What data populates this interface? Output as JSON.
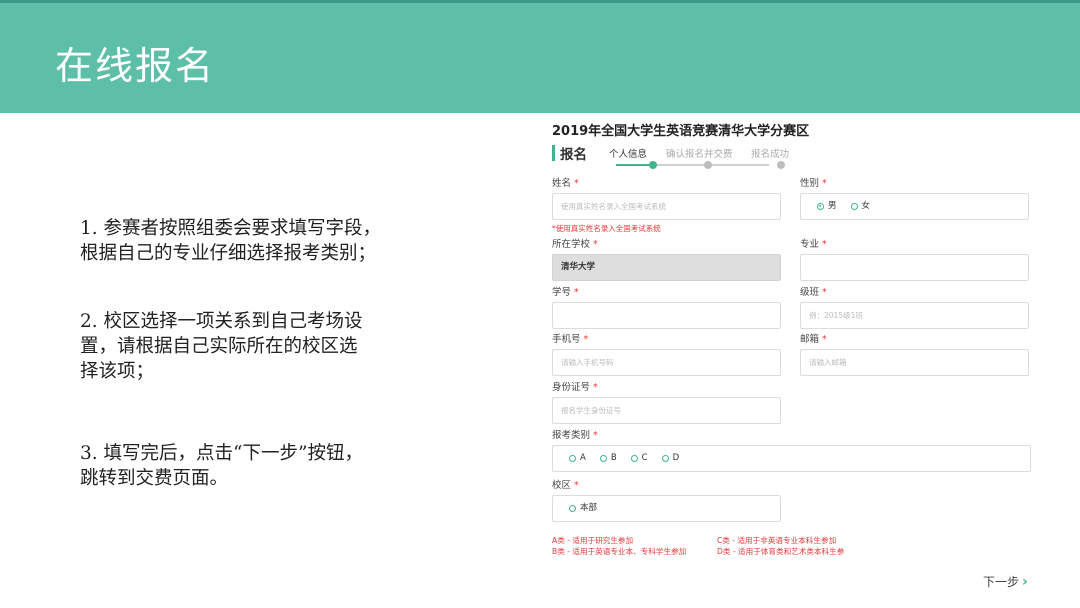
{
  "slide": {
    "title": "在线报名"
  },
  "instructions": [
    {
      "line1": "1. 参赛者按照组委会要求填写字段，",
      "line2": "根据自己的专业仔细选择报考类别；"
    },
    {
      "line1": "2. 校区选择一项关系到自己考场设",
      "line2": "置，请根据自己实际所在的校区选",
      "line3": "择该项；"
    },
    {
      "line1": "3. 填写完后，点击“下一步”按钮，",
      "line2": "跳转到交费页面。"
    }
  ],
  "form": {
    "heading": "2019年全国大学生英语竞赛清华大学分赛区",
    "section_label": "报名",
    "steps": [
      "个人信息",
      "确认报名并交费",
      "报名成功"
    ],
    "current_step": 1,
    "required_mark": "*",
    "name": {
      "label": "姓名",
      "placeholder": "使用真实姓名录入全国考试系统",
      "hint": "*使用真实姓名录入全国考试系统"
    },
    "gender": {
      "label": "性别",
      "options": [
        "男",
        "女"
      ],
      "selected": "男"
    },
    "school": {
      "label": "所在学校",
      "value": "清华大学"
    },
    "major": {
      "label": "专业",
      "placeholder": ""
    },
    "student_id": {
      "label": "学号",
      "placeholder": ""
    },
    "class": {
      "label": "级班",
      "placeholder": "例：2015级1班"
    },
    "phone": {
      "label": "手机号",
      "placeholder": "请输入手机号码"
    },
    "email": {
      "label": "邮箱",
      "placeholder": "请输入邮箱"
    },
    "id_number": {
      "label": "身份证号",
      "placeholder": "报名学生身份证号"
    },
    "category": {
      "label": "报考类别",
      "options": [
        "A",
        "B",
        "C",
        "D"
      ]
    },
    "campus": {
      "label": "校区",
      "options": [
        "本部"
      ]
    },
    "legend": [
      "A类 - 适用于研究生参加",
      "C类 - 适用于非英语专业本科生参加",
      "B类 - 适用于英语专业本、专科学生参加",
      "D类 - 适用于体育类和艺术类本科生参"
    ],
    "next_label": "下一步",
    "next_icon": "chevron-right-icon"
  },
  "colors": {
    "header": "#5dbfa8",
    "accent": "#3fb58f",
    "required": "#e23a3a"
  }
}
